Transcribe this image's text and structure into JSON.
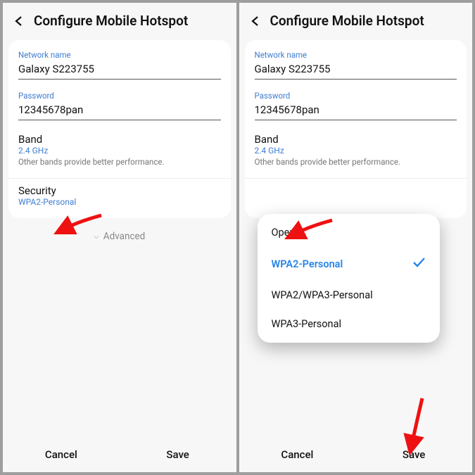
{
  "header": {
    "title": "Configure Mobile Hotspot"
  },
  "network": {
    "label": "Network name",
    "value": "Galaxy S223755"
  },
  "password": {
    "label": "Password",
    "value": "12345678pan"
  },
  "band": {
    "title": "Band",
    "value": "2.4 GHz",
    "hint": "Other bands provide better performance."
  },
  "security": {
    "title": "Security",
    "value": "WPA2-Personal"
  },
  "advanced": "Advanced",
  "menu": {
    "open": "Open",
    "wpa2": "WPA2-Personal",
    "wpa23": "WPA2/WPA3-Personal",
    "wpa3": "WPA3-Personal"
  },
  "footer": {
    "cancel": "Cancel",
    "save": "Save"
  }
}
